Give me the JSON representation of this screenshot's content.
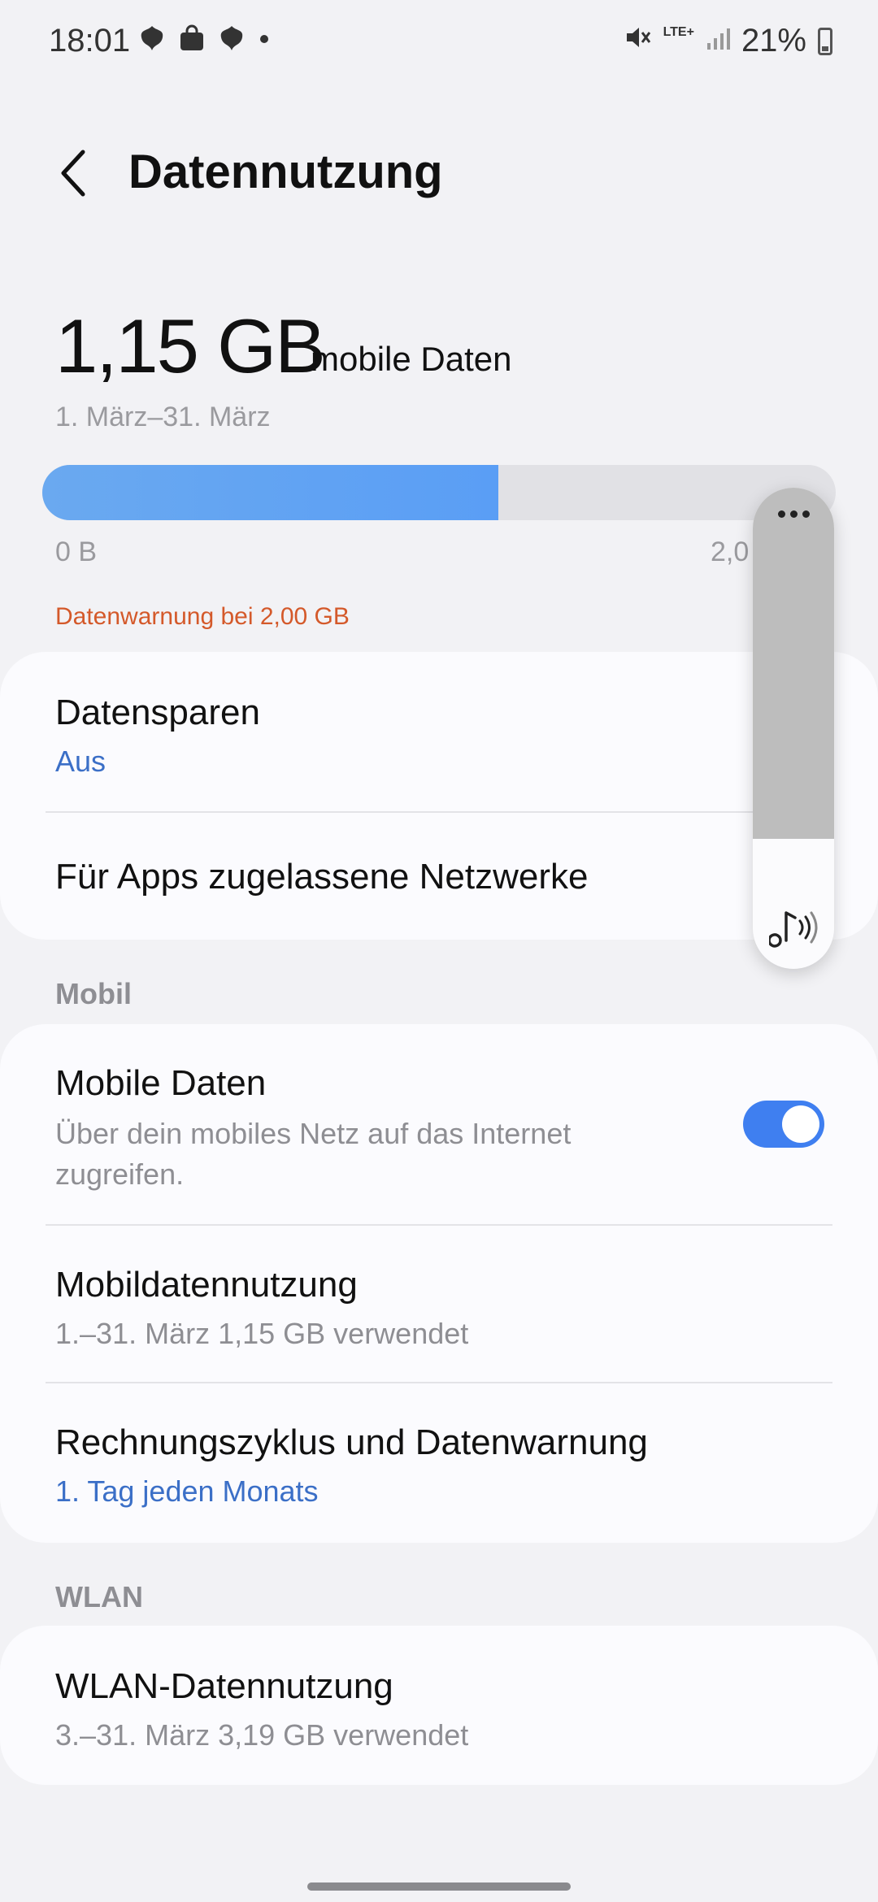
{
  "status_bar": {
    "time": "18:01",
    "network": "LTE+",
    "battery": "21%",
    "icons": [
      "leaf-icon",
      "shopping-bag-icon",
      "leaf-icon",
      "dot-icon",
      "mute-icon",
      "lte-icon",
      "signal-icon",
      "battery-icon"
    ]
  },
  "header": {
    "back_icon": "back-arrow-icon",
    "title": "Datennutzung"
  },
  "usage": {
    "amount": "1,15 GB",
    "label": "mobile Daten",
    "period": "1. März–31. März",
    "bar_min": "0 B",
    "bar_max_visible": "2,0",
    "fill_fraction": 0.575,
    "warning": "Datenwarnung bei 2,00 GB",
    "bar_color": "#5a9ef5",
    "warning_color": "#d4592a"
  },
  "settings": {
    "data_saver": {
      "title": "Datensparen",
      "value": "Aus"
    },
    "allowed_networks": {
      "title": "Für Apps zugelassene Netzwerke"
    }
  },
  "mobile": {
    "section": "Mobil",
    "mobile_data": {
      "title": "Mobile Daten",
      "subtitle_line1": "Über dein mobiles Netz auf das Internet",
      "subtitle_line2": "zugreifen.",
      "enabled": true
    },
    "mobile_usage": {
      "title": "Mobildatennutzung",
      "subtitle": "1.–31. März 1,15 GB verwendet"
    },
    "billing": {
      "title": "Rechnungszyklus und Datenwarnung",
      "value": "1. Tag jeden Monats"
    }
  },
  "wlan": {
    "section": "WLAN",
    "usage": {
      "title": "WLAN-Datennutzung",
      "subtitle": "3.–31. März 3,19 GB verwendet"
    }
  },
  "volume_overlay": {
    "level_fraction": 0.27,
    "icon": "music-note-icon",
    "more_icon": "more-options-icon"
  },
  "accent_color": "#3f7ff0"
}
